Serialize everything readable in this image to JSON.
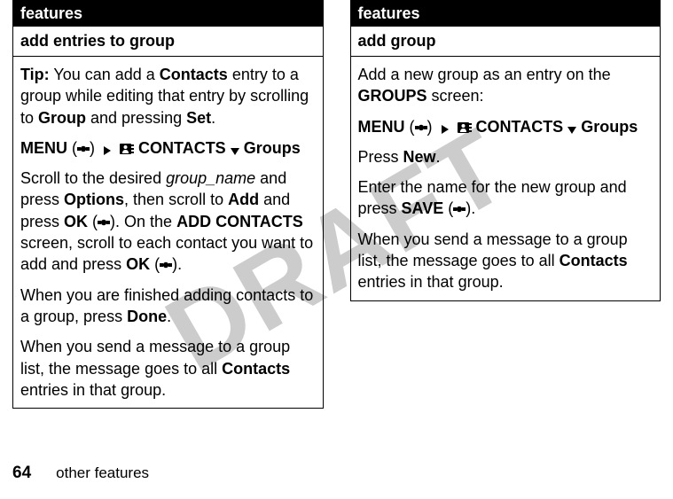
{
  "watermark": "DRAFT",
  "left": {
    "header": "features",
    "title": "add entries to group",
    "tip_label": "Tip:",
    "tip_text1": " You can add a ",
    "contacts_word": "Contacts",
    "tip_text2": " entry to a group while editing that entry by scrolling to ",
    "group_word": "Group",
    "tip_text3": " and pressing ",
    "set_word": "Set",
    "tip_text4": ".",
    "menu_word": "MENU",
    "contacts_menu": "CONTACTS",
    "groups_menu": "Groups",
    "p2a": "Scroll to the desired ",
    "group_name": "group_name",
    "p2b": " and press ",
    "options_word": "Options",
    "p2c": ", then scroll to ",
    "add_word": "Add",
    "p2d": " and press ",
    "ok_word": "OK",
    "p2e": ". On the ",
    "add_contacts": "ADD CONTACTS",
    "p2f": " screen, scroll to each contact you want to add and press ",
    "p2g": ".",
    "p3a": "When you are finished adding contacts to a group, press ",
    "done_word": "Done",
    "p3b": ".",
    "p4a": "When you send a message to a group list, the message goes to all ",
    "p4b": " entries in that group."
  },
  "right": {
    "header": "features",
    "title": "add group",
    "p1a": "Add a new group as an entry on the ",
    "groups_word": "GROUPS",
    "p1b": " screen:",
    "menu_word": "MENU",
    "contacts_menu": "CONTACTS",
    "groups_menu": "Groups",
    "p2a": "Press ",
    "new_word": "New",
    "p2b": ".",
    "p3a": "Enter the name for the new group and press ",
    "save_word": "SAVE",
    "p3b": ".",
    "p4a": "When you send a message to a group list, the message goes to all ",
    "contacts_word": "Contacts",
    "p4b": " entries in that group."
  },
  "footer": {
    "page": "64",
    "label": "other features"
  }
}
